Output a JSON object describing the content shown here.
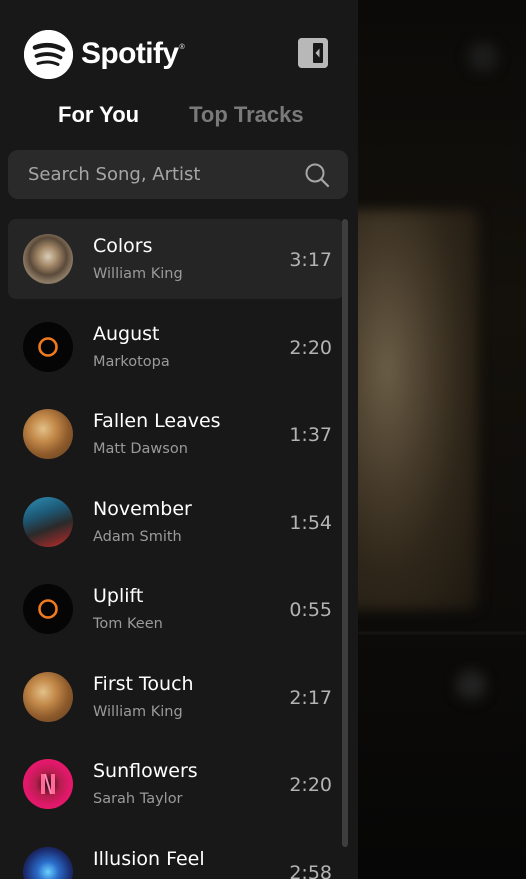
{
  "app": {
    "brand": "Spotify",
    "brand_mark": "®"
  },
  "sidebar": {
    "collapse_icon": "panel-collapse-icon",
    "tabs": [
      {
        "label": "For You",
        "active": true
      },
      {
        "label": "Top Tracks",
        "active": false
      }
    ],
    "search": {
      "placeholder": "Search Song, Artist",
      "icon": "search-icon"
    },
    "tracks": [
      {
        "title": "Colors",
        "artist": "William King",
        "duration": "3:17",
        "active": true
      },
      {
        "title": "August",
        "artist": "Markotopa",
        "duration": "2:20",
        "active": false
      },
      {
        "title": "Fallen Leaves",
        "artist": "Matt Dawson",
        "duration": "1:37",
        "active": false
      },
      {
        "title": "November",
        "artist": "Adam Smith",
        "duration": "1:54",
        "active": false
      },
      {
        "title": "Uplift",
        "artist": "Tom Keen",
        "duration": "0:55",
        "active": false
      },
      {
        "title": "First Touch",
        "artist": "William King",
        "duration": "2:17",
        "active": false
      },
      {
        "title": "Sunflowers",
        "artist": "Sarah Taylor",
        "duration": "2:20",
        "active": false
      },
      {
        "title": "Illusion Feel",
        "artist": "",
        "duration": "2:58",
        "active": false
      }
    ]
  },
  "colors": {
    "sidebar_bg": "#181818",
    "active_row": "#252525",
    "search_bg": "#2a2a2a",
    "inactive_tab": "#7a7a7a",
    "ring_accent": "#f07b1e"
  }
}
